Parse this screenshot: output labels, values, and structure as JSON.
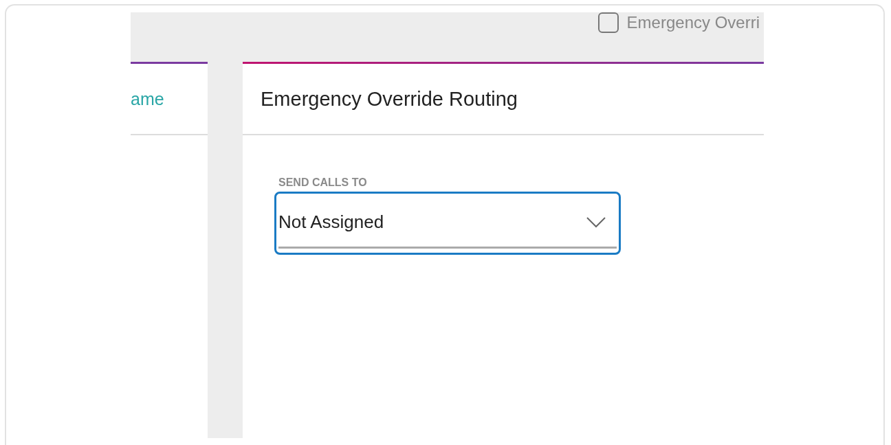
{
  "top_bar": {
    "checkbox": {
      "label": "Emergency Overri",
      "checked": false
    }
  },
  "left_column": {
    "header": "ame"
  },
  "panel": {
    "title": "Emergency Override Routing",
    "field": {
      "label": "SEND CALLS TO",
      "value": "Not Assigned",
      "focused": true
    }
  }
}
